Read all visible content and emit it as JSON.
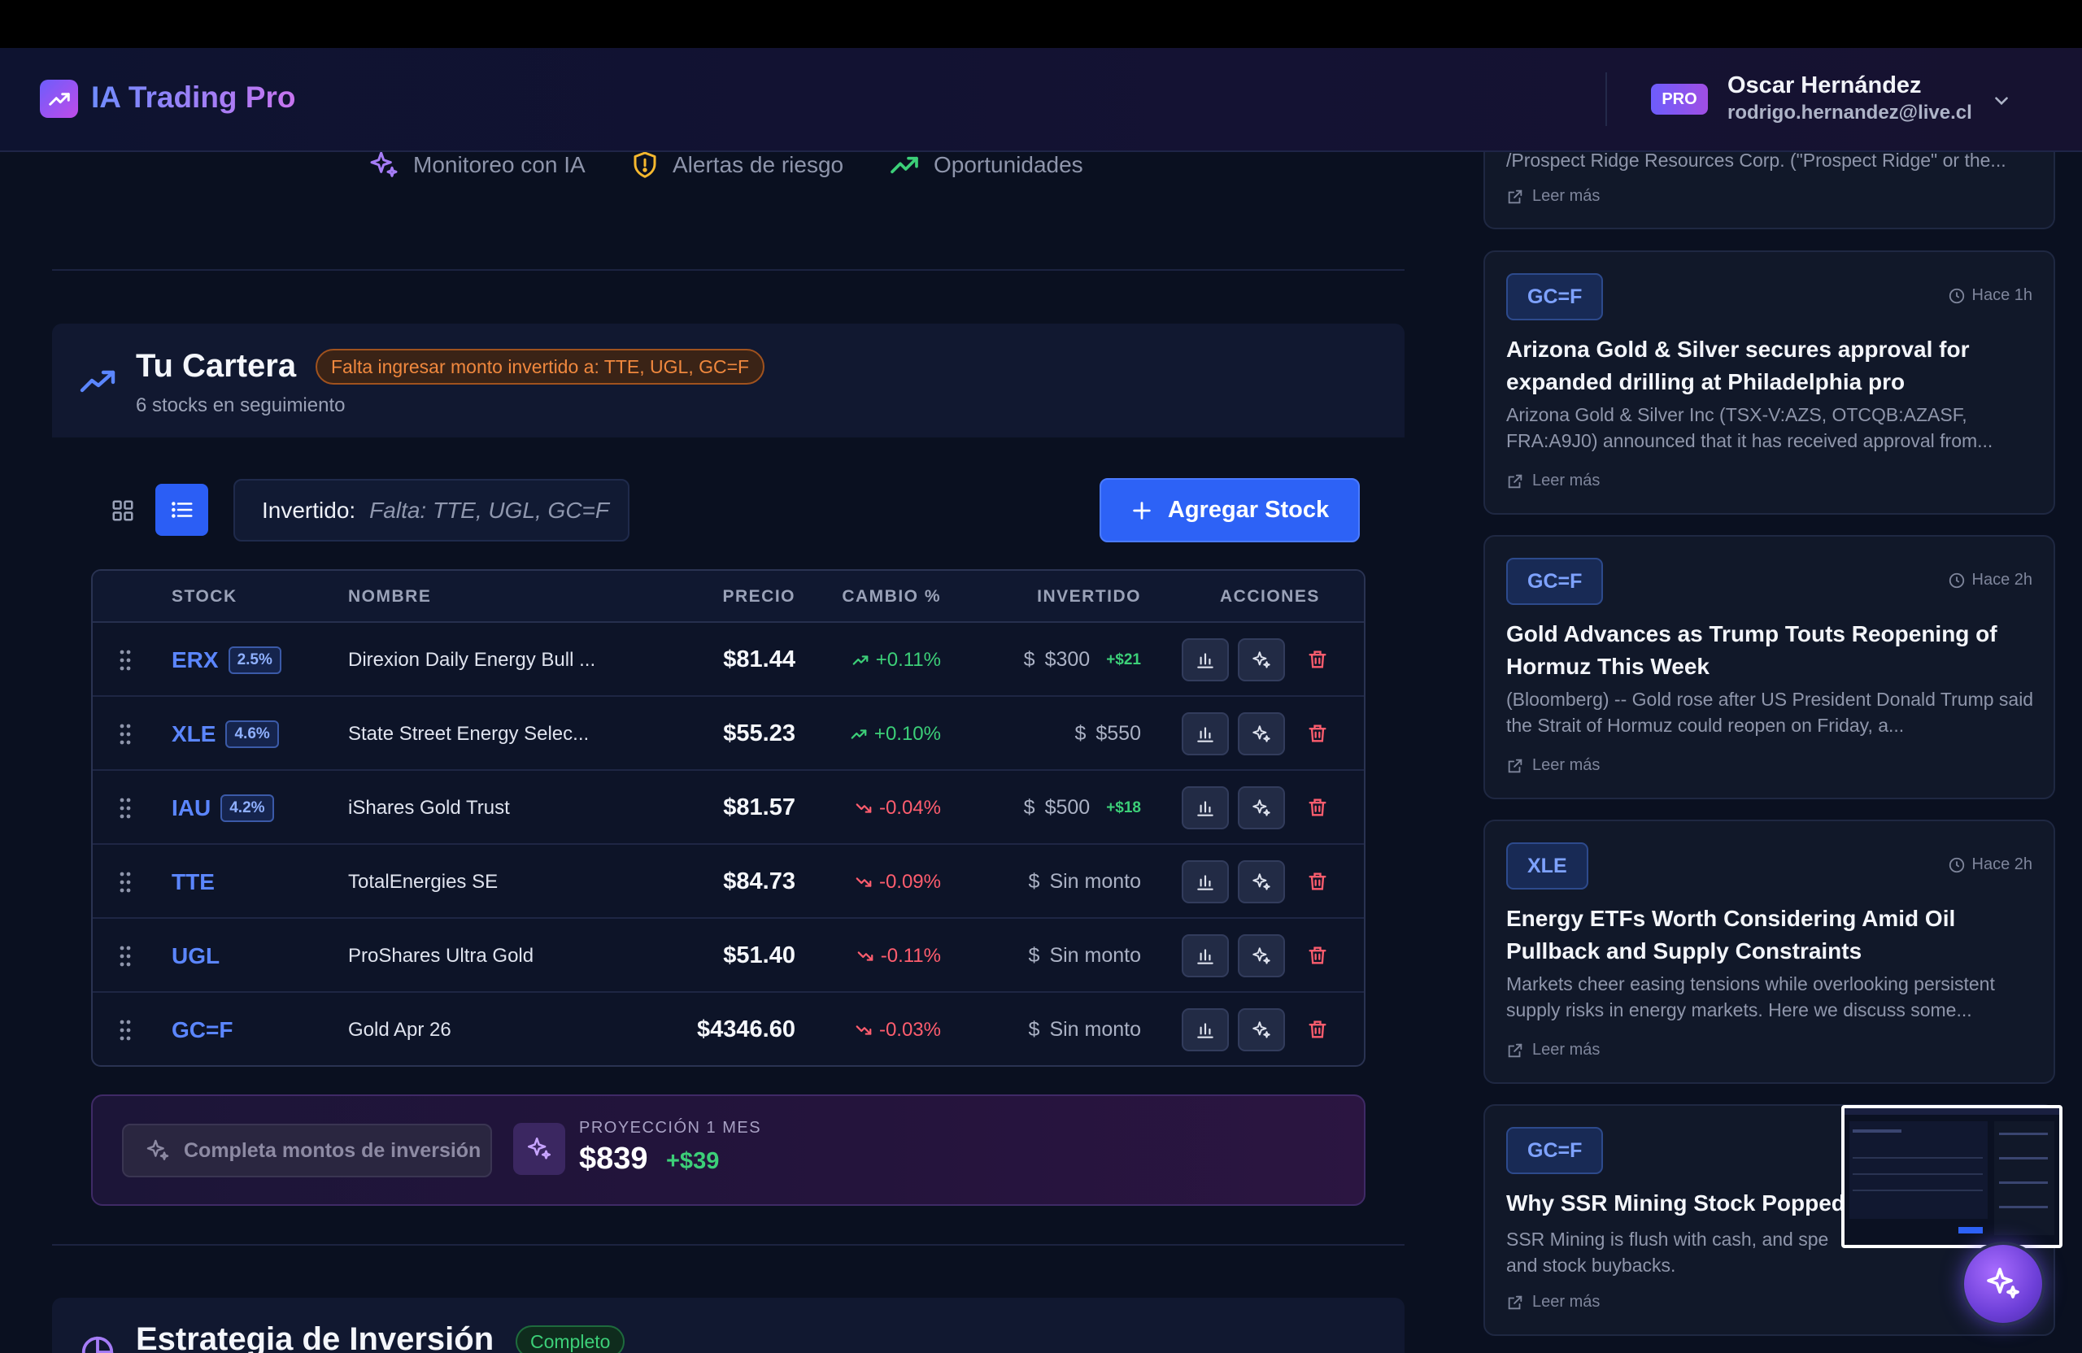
{
  "app": {
    "title": "IA Trading Pro"
  },
  "user": {
    "badge": "PRO",
    "name": "Oscar Hernández",
    "email": "rodrigo.hernandez@live.cl"
  },
  "features": [
    {
      "label": "Monitoreo con IA",
      "icon": "sparkles-icon"
    },
    {
      "label": "Alertas de riesgo",
      "icon": "shield-alert-icon"
    },
    {
      "label": "Oportunidades",
      "icon": "trending-up-icon"
    }
  ],
  "portfolio": {
    "title": "Tu Cartera",
    "warning": "Falta ingresar monto invertido a: TTE, UGL, GC=F",
    "subtitle": "6 stocks en seguimiento",
    "invested_label": "Invertido:",
    "invested_value": "Falta: TTE, UGL, GC=F",
    "add_button": "Agregar Stock"
  },
  "table": {
    "headers": {
      "stock": "STOCK",
      "name": "NOMBRE",
      "price": "PRECIO",
      "change": "CAMBIO %",
      "invested": "INVERTIDO",
      "actions": "ACCIONES"
    },
    "rows": [
      {
        "ticker": "ERX",
        "weight": "2.5%",
        "name": "Direxion Daily Energy Bull ...",
        "price": "$81.44",
        "change": "+0.11%",
        "dir": "up",
        "currency": "$",
        "invested": "$300",
        "gain": "+$21"
      },
      {
        "ticker": "XLE",
        "weight": "4.6%",
        "name": "State Street Energy Selec...",
        "price": "$55.23",
        "change": "+0.10%",
        "dir": "up",
        "currency": "$",
        "invested": "$550",
        "gain": ""
      },
      {
        "ticker": "IAU",
        "weight": "4.2%",
        "name": "iShares Gold Trust",
        "price": "$81.57",
        "change": "-0.04%",
        "dir": "down",
        "currency": "$",
        "invested": "$500",
        "gain": "+$18"
      },
      {
        "ticker": "TTE",
        "weight": "",
        "name": "TotalEnergies SE",
        "price": "$84.73",
        "change": "-0.09%",
        "dir": "down",
        "currency": "$",
        "invested": "Sin monto",
        "gain": ""
      },
      {
        "ticker": "UGL",
        "weight": "",
        "name": "ProShares Ultra Gold",
        "price": "$51.40",
        "change": "-0.11%",
        "dir": "down",
        "currency": "$",
        "invested": "Sin monto",
        "gain": ""
      },
      {
        "ticker": "GC=F",
        "weight": "",
        "name": "Gold Apr 26",
        "price": "$4346.60",
        "change": "-0.03%",
        "dir": "down",
        "currency": "$",
        "invested": "Sin monto",
        "gain": ""
      }
    ]
  },
  "projection": {
    "button": "Completa montos de inversión",
    "label": "PROYECCIÓN 1 MES",
    "value": "$839",
    "gain": "+$39"
  },
  "strategy": {
    "title": "Estrategia de Inversión",
    "badge": "Completo"
  },
  "news": [
    {
      "tag": "",
      "time": "",
      "title": "",
      "body": "/Prospect Ridge Resources Corp. (\"Prospect Ridge\" or the...",
      "more": "Leer más"
    },
    {
      "tag": "GC=F",
      "time": "Hace 1h",
      "title": "Arizona Gold & Silver secures approval for expanded drilling at Philadelphia pro",
      "body": "Arizona Gold & Silver Inc (TSX-V:AZS, OTCQB:AZASF, FRA:A9J0) announced that it has received approval from...",
      "more": "Leer más"
    },
    {
      "tag": "GC=F",
      "time": "Hace 2h",
      "title": "Gold Advances as Trump Touts Reopening of Hormuz This Week",
      "body": "(Bloomberg) -- Gold rose after US President Donald Trump said the Strait of Hormuz could reopen on Friday, a...",
      "more": "Leer más"
    },
    {
      "tag": "XLE",
      "time": "Hace 2h",
      "title": "Energy ETFs Worth Considering Amid Oil Pullback and Supply Constraints",
      "body": "Markets cheer easing tensions while overlooking persistent supply risks in energy markets. Here we discuss some...",
      "more": "Leer más"
    },
    {
      "tag": "GC=F",
      "time": "",
      "title": "Why SSR Mining Stock Popped",
      "body": "SSR Mining is flush with cash, and spe and stock buybacks.",
      "more": "Leer más"
    }
  ],
  "colors": {
    "accent": "#2d62f6",
    "up": "#3ccf78",
    "down": "#ff5d6e",
    "warning": "#f0883e",
    "brand_from": "#6d5dfc",
    "brand_to": "#c04be8"
  }
}
